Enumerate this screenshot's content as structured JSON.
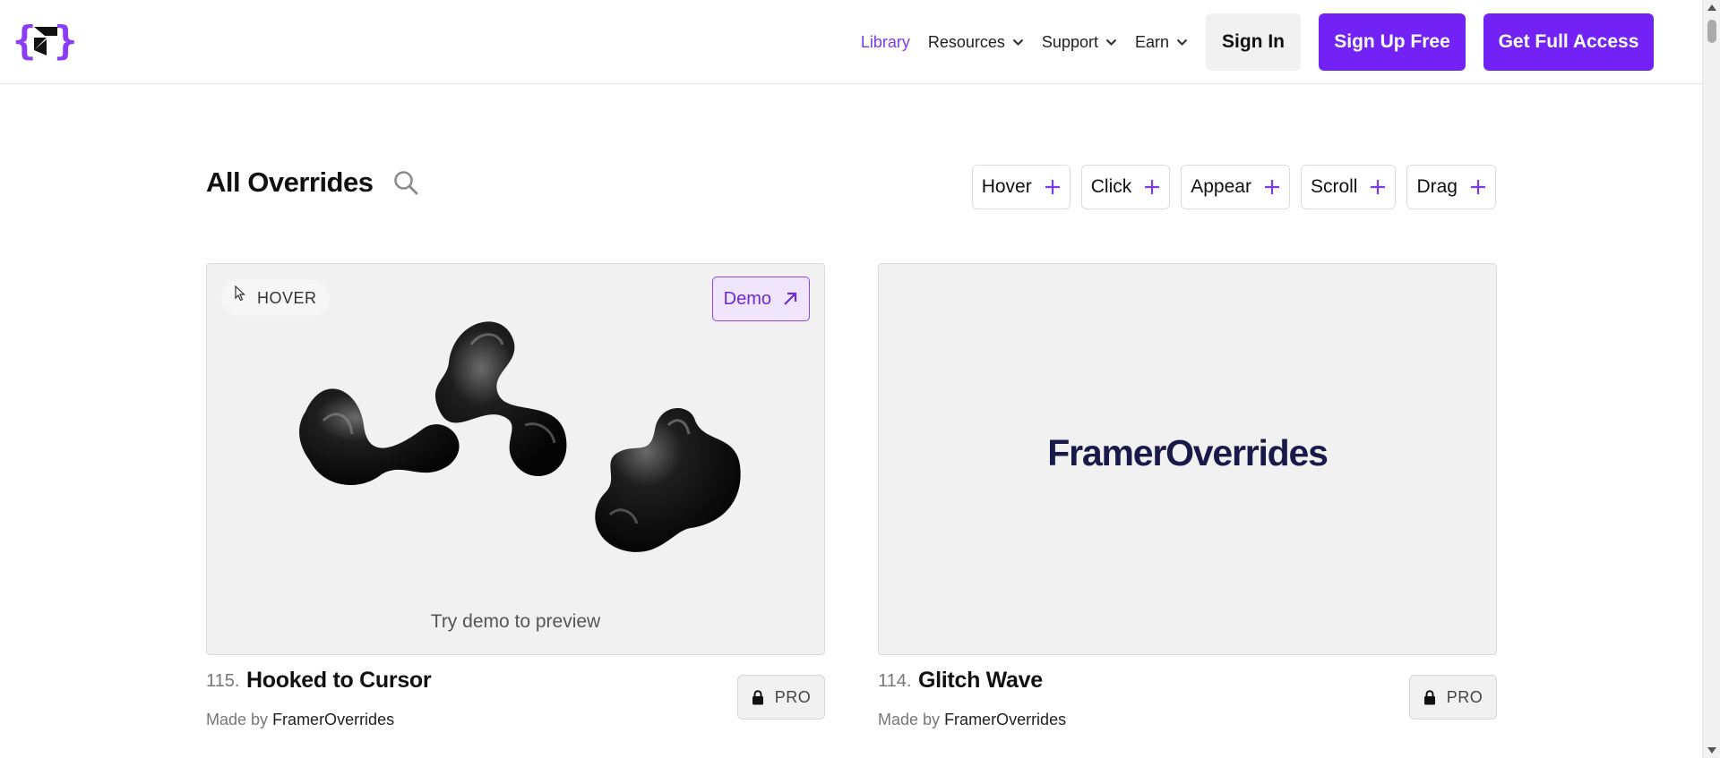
{
  "header": {
    "logo_icon": "framer-overrides-logo-icon",
    "nav": [
      {
        "label": "Library",
        "active": true,
        "has_dropdown": false
      },
      {
        "label": "Resources",
        "active": false,
        "has_dropdown": true
      },
      {
        "label": "Support",
        "active": false,
        "has_dropdown": true
      },
      {
        "label": "Earn",
        "active": false,
        "has_dropdown": true
      }
    ],
    "sign_in_label": "Sign In",
    "sign_up_label": "Sign Up Free",
    "full_access_label": "Get Full Access"
  },
  "toolbar": {
    "title": "All Overrides",
    "search_icon": "search-icon",
    "filters": [
      "Hover",
      "Click",
      "Appear",
      "Scroll",
      "Drag"
    ]
  },
  "cards": [
    {
      "number": "115.",
      "title": "Hooked to Cursor",
      "tag": "HOVER",
      "demo_label": "Demo",
      "preview_caption": "Try demo to preview",
      "made_by_prefix": "Made by",
      "author": "FramerOverrides",
      "pro_label": "PRO"
    },
    {
      "number": "114.",
      "title": "Glitch Wave",
      "wordmark": "FramerOverrides",
      "made_by_prefix": "Made by",
      "author": "FramerOverrides",
      "pro_label": "PRO"
    }
  ],
  "colors": {
    "accent": "#7222f5",
    "accent_text": "#7c3aed",
    "wordmark": "#1a1a4a"
  }
}
